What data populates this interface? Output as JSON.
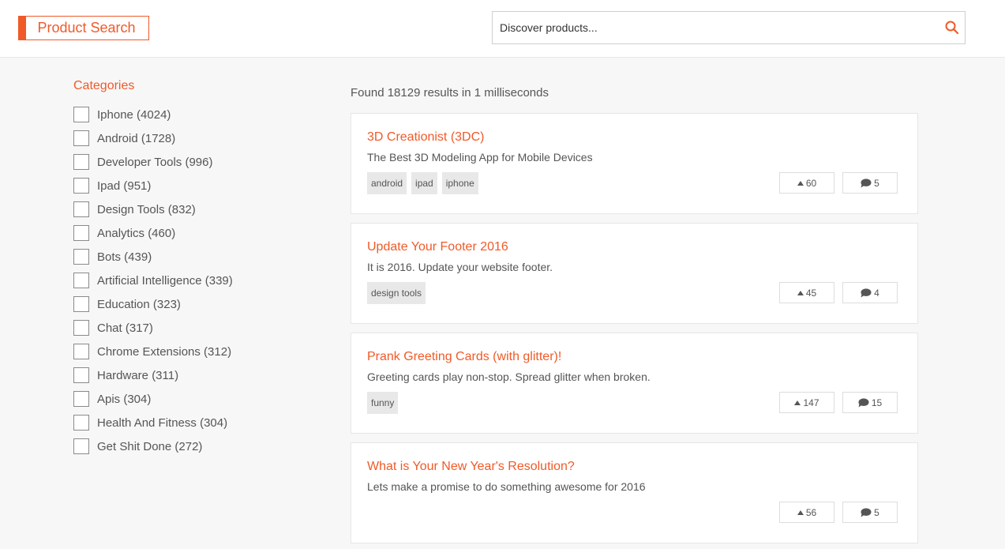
{
  "header": {
    "logo_text": "Product Search",
    "search_placeholder": "Discover products..."
  },
  "sidebar": {
    "title": "Categories",
    "items": [
      {
        "label": "Iphone (4024)"
      },
      {
        "label": "Android (1728)"
      },
      {
        "label": "Developer Tools (996)"
      },
      {
        "label": "Ipad (951)"
      },
      {
        "label": "Design Tools (832)"
      },
      {
        "label": "Analytics (460)"
      },
      {
        "label": "Bots (439)"
      },
      {
        "label": "Artificial Intelligence (339)"
      },
      {
        "label": "Education (323)"
      },
      {
        "label": "Chat (317)"
      },
      {
        "label": "Chrome Extensions (312)"
      },
      {
        "label": "Hardware (311)"
      },
      {
        "label": "Apis (304)"
      },
      {
        "label": "Health And Fitness (304)"
      },
      {
        "label": "Get Shit Done (272)"
      }
    ]
  },
  "results": {
    "summary": "Found 18129 results in 1 milliseconds",
    "items": [
      {
        "title": "3D Creationist (3DC)",
        "desc": "The Best 3D Modeling App for Mobile Devices",
        "tags": [
          "android",
          "ipad",
          "iphone"
        ],
        "votes": "60",
        "comments": "5"
      },
      {
        "title": "Update Your Footer 2016",
        "desc": "It is 2016. Update your website footer.",
        "tags": [
          "design tools"
        ],
        "votes": "45",
        "comments": "4"
      },
      {
        "title": "Prank Greeting Cards (with glitter)!",
        "desc": "Greeting cards play non-stop. Spread glitter when broken.",
        "tags": [
          "funny"
        ],
        "votes": "147",
        "comments": "15"
      },
      {
        "title": "What is Your New Year's Resolution?",
        "desc": "Lets make a promise to do something awesome for 2016",
        "tags": [],
        "votes": "56",
        "comments": "5"
      }
    ]
  },
  "colors": {
    "accent": "#f05a28",
    "background": "#f7f7f7"
  }
}
